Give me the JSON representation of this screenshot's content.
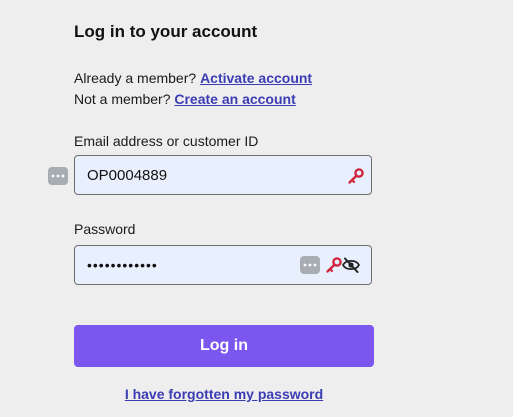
{
  "heading": "Log in to your account",
  "member_prompt": {
    "text": "Already a member?",
    "link": "Activate account"
  },
  "non_member_prompt": {
    "text": "Not a member?",
    "link": "Create an account"
  },
  "email": {
    "label": "Email address or customer ID",
    "value": "OP0004889"
  },
  "password": {
    "label": "Password",
    "masked_value": "••••••••••••"
  },
  "login_button": "Log in",
  "forgot_link": "I have forgotten my password",
  "colors": {
    "accent": "#7b57f0",
    "link": "#3c3cb4",
    "field_bg": "#e8f0fe",
    "key_icon": "#d0263c"
  },
  "icons": [
    "password-manager-icon",
    "key-icon",
    "eye-slash-icon"
  ]
}
